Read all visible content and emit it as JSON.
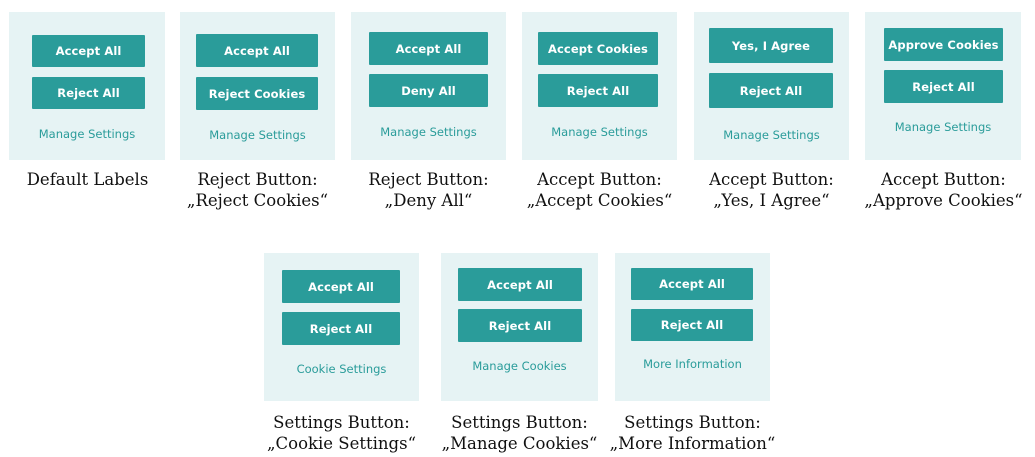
{
  "variants": [
    {
      "accept_label": "Accept All",
      "reject_label": "Reject All",
      "settings_label": "Manage Settings",
      "caption_line1": "Default Labels",
      "caption_line2": ""
    },
    {
      "accept_label": "Accept All",
      "reject_label": "Reject Cookies",
      "settings_label": "Manage Settings",
      "caption_line1": "Reject Button:",
      "caption_line2": "„Reject Cookies“"
    },
    {
      "accept_label": "Accept All",
      "reject_label": "Deny All",
      "settings_label": "Manage Settings",
      "caption_line1": "Reject Button:",
      "caption_line2": "„Deny All“"
    },
    {
      "accept_label": "Accept Cookies",
      "reject_label": "Reject All",
      "settings_label": "Manage Settings",
      "caption_line1": "Accept Button:",
      "caption_line2": "„Accept Cookies“"
    },
    {
      "accept_label": "Yes, I Agree",
      "reject_label": "Reject All",
      "settings_label": "Manage Settings",
      "caption_line1": "Accept Button:",
      "caption_line2": "„Yes, I Agree“"
    },
    {
      "accept_label": "Approve Cookies",
      "reject_label": "Reject All",
      "settings_label": "Manage Settings",
      "caption_line1": "Accept Button:",
      "caption_line2": "„Approve Cookies“"
    },
    {
      "accept_label": "Accept All",
      "reject_label": "Reject All",
      "settings_label": "Cookie Settings",
      "caption_line1": "Settings Button:",
      "caption_line2": "„Cookie Settings“"
    },
    {
      "accept_label": "Accept All",
      "reject_label": "Reject All",
      "settings_label": "Manage Cookies",
      "caption_line1": "Settings Button:",
      "caption_line2": "„Manage Cookies“"
    },
    {
      "accept_label": "Accept All",
      "reject_label": "Reject All",
      "settings_label": "More Information",
      "caption_line1": "Settings Button:",
      "caption_line2": "„More Information“"
    }
  ],
  "colors": {
    "card_background": "#e6f3f4",
    "button_background": "#2a9c9a",
    "button_text": "#ffffff",
    "link_text": "#2a9c9a",
    "caption_text": "#111111"
  }
}
